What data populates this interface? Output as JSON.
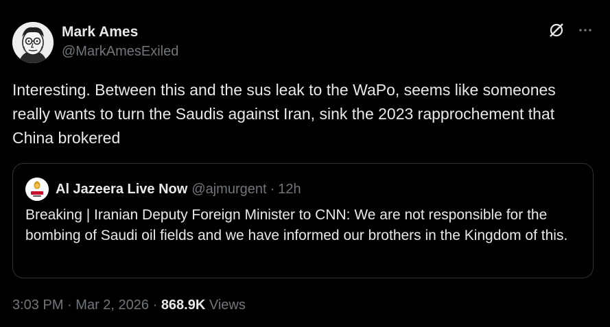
{
  "author": {
    "display_name": "Mark Ames",
    "handle": "@MarkAmesExiled",
    "avatar_icon": "cartoon-portrait-avatar"
  },
  "top_actions": {
    "grok_icon": "grok-icon",
    "more_icon": "more-horizontal-icon"
  },
  "tweet": {
    "text": "Interesting. Between this and the sus leak to the WaPo, seems like someones really wants to turn the Saudis against Iran, sink the 2023 rapprochement that China brokered"
  },
  "quote": {
    "display_name": "Al Jazeera Live Now",
    "handle": "@ajmurgent",
    "separator": "·",
    "time": "12h",
    "avatar_icon": "al-jazeera-logo",
    "text": "Breaking | Iranian Deputy Foreign Minister to CNN: We are not responsible for the bombing of Saudi oil fields and we have informed our brothers in the Kingdom of this."
  },
  "meta": {
    "time": "3:03 PM",
    "sep1": "·",
    "date": "Mar 2, 2026",
    "sep2": "·",
    "views_count": "868.9K",
    "views_label": "Views"
  },
  "colors": {
    "background": "#000000",
    "primary_text": "#e7e9ea",
    "secondary_text": "#71767b",
    "border": "#2f3336",
    "al_jazeera_gold": "#d69a1d",
    "al_jazeera_red": "#c8102e"
  }
}
